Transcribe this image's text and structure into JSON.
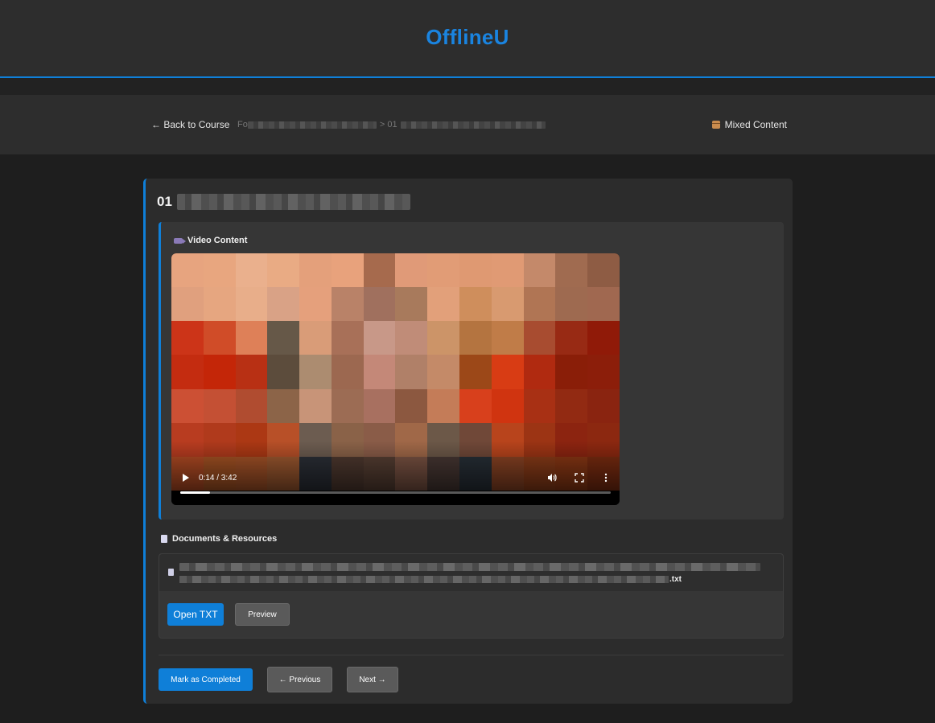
{
  "app": {
    "title": "OfflineU"
  },
  "nav": {
    "back_label": "← Back to Course",
    "breadcrumb_prefix": "Fo",
    "breadcrumb_separator": "> 01",
    "content_type_label": "Mixed Content"
  },
  "lesson": {
    "title_prefix": "01"
  },
  "video": {
    "heading": "Video Content",
    "time_display": "0:14 / 3:42",
    "progress_fraction": 0.07
  },
  "documents": {
    "heading": "Documents & Resources",
    "file_extension": ".txt",
    "open_label": "Open TXT",
    "preview_label": "Preview"
  },
  "actions": {
    "complete_label": "Mark as Completed",
    "previous_label": "← Previous",
    "next_label": "Next →"
  },
  "colors": {
    "accent": "#0f7fd8",
    "brand": "#1a84e0"
  }
}
